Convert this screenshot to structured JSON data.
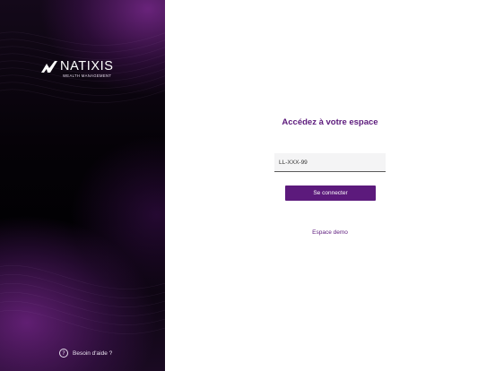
{
  "brand": {
    "name": "NATIXIS",
    "subtitle": "WEALTH MANAGEMENT",
    "logo_icon": "natixis-n-mark-icon",
    "color": "#5c1a7c"
  },
  "sidebar": {
    "help_label": "Besoin d'aide ?",
    "help_icon": "question-circle-icon"
  },
  "login": {
    "title": "Accédez à votre espace",
    "input_value": "LL-XXX-99",
    "connect_label": "Se connecter",
    "demo_label": "Espace demo"
  }
}
